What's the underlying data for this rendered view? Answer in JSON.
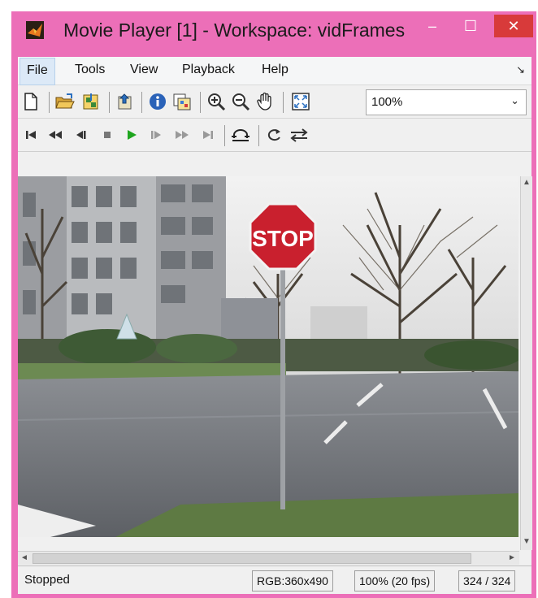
{
  "window": {
    "title": "Movie Player [1] - Workspace: vidFrames",
    "minimize_glyph": "–",
    "maximize_glyph": "☐",
    "close_glyph": "✕"
  },
  "menu": {
    "items": [
      "File",
      "Tools",
      "View",
      "Playback",
      "Help"
    ],
    "overflow_glyph": "↘"
  },
  "toolbar": {
    "zoom_value": "100%",
    "zoom_dropdown_glyph": "⌄",
    "icons": [
      "new-file-icon",
      "open-folder-icon",
      "import-icon",
      "export-icon",
      "info-icon",
      "colormap-icon",
      "zoom-in-icon",
      "zoom-out-icon",
      "pan-hand-icon",
      "fit-to-window-icon"
    ]
  },
  "playback": {
    "icons": [
      "go-to-first-icon",
      "rewind-icon",
      "step-back-icon",
      "stop-icon",
      "play-icon",
      "step-forward-icon",
      "fast-forward-icon",
      "go-to-last-icon",
      "jump-to-icon",
      "loop-icon",
      "playback-direction-icon"
    ],
    "play_color": "#1ea51e"
  },
  "video": {
    "sign_text": "STOP"
  },
  "scroll": {
    "up_glyph": "▲",
    "down_glyph": "▼",
    "left_glyph": "◄",
    "right_glyph": "►"
  },
  "status": {
    "state": "Stopped",
    "image_type": "RGB:360x490",
    "zoom_fps": "100% (20 fps)",
    "frame": "324 / 324"
  },
  "colors": {
    "window_frame": "#ec6fb8",
    "close_button": "#d83a3a",
    "stop_sign": "#c9202e"
  }
}
